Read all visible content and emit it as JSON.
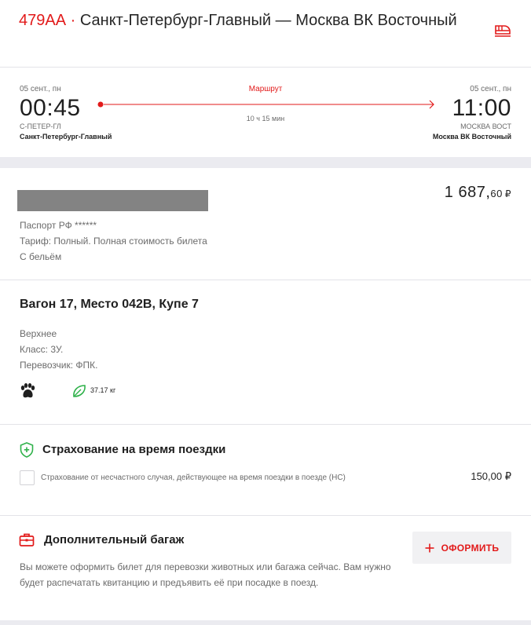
{
  "header": {
    "train_number": "479АА",
    "separator": "·",
    "route_title": "Санкт-Петербург-Главный — Москва ВК Восточный"
  },
  "route": {
    "departure": {
      "date": "05 сент., пн",
      "time": "00:45",
      "code": "С-ПЕТЕР-ГЛ",
      "station": "Санкт-Петербург-Главный"
    },
    "arrival": {
      "date": "05 сент., пн",
      "time": "11:00",
      "code": "МОСКВА ВОСТ",
      "station": "Москва ВК Восточный"
    },
    "route_link": "Маршрут",
    "duration": "10 ч 15 мин"
  },
  "passenger": {
    "price_main": "1 687,",
    "price_cents": "60",
    "currency": "₽",
    "document": "Паспорт РФ ******",
    "tariff": "Тариф: Полный.   Полная стоимость билета",
    "linen": "С бельём"
  },
  "seat": {
    "heading": "Вагон 17, Место 042В, Купе 7",
    "position": "Верхнее",
    "class": "Класс: 3У.",
    "carrier": "Перевозчик: ФПК.",
    "co2": "37.17 кг"
  },
  "insurance": {
    "heading": "Страхование на время поездки",
    "description": "Страхование от несчастного случая, действующее на время поездки в поезде (НС)",
    "price": "150,00 ₽",
    "checked": false
  },
  "baggage": {
    "heading": "Дополнительный багаж",
    "description": "Вы можете оформить билет для перевозки животных или багажа сейчас. Вам нужно будет распечатать квитанцию и предъявить её при посадке в поезд.",
    "button_label": "ОФОРМИТЬ"
  },
  "icons": {
    "train": "train-icon",
    "paw": "paw-icon",
    "leaf": "leaf-icon",
    "shield": "shield-plus-icon",
    "bag": "briefcase-icon",
    "plus": "plus-icon"
  },
  "colors": {
    "accent": "#e21a1a",
    "eco_green": "#2fb14a",
    "text": "#1f1f1f",
    "muted": "#6b6b6b",
    "separator": "#ebebf0"
  }
}
